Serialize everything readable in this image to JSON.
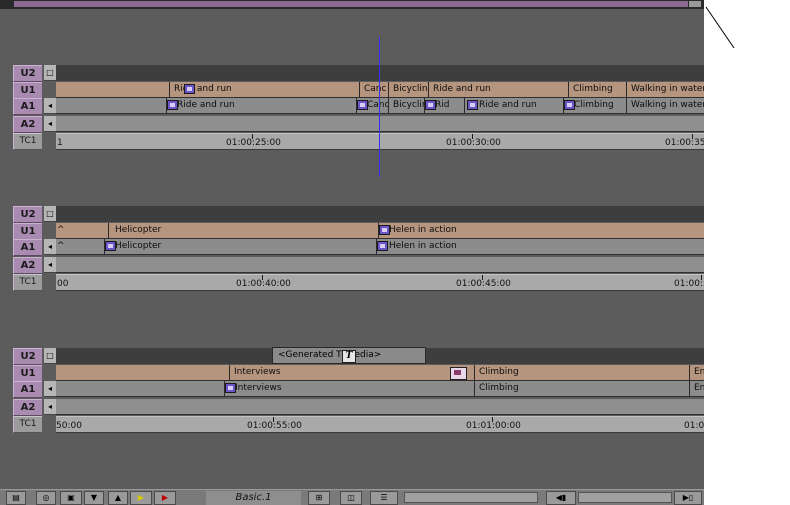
{
  "colors": {
    "video_track": "#b6957f",
    "audio_track": "#8c8c8c",
    "label": "#a98ab0",
    "cursor": "#3030ff"
  },
  "groups": [
    {
      "tracks": {
        "v2": "U2",
        "v1": "U1",
        "a1": "A1",
        "a2": "A2",
        "tc": "TC1"
      },
      "v1_clips": [
        "Ride and run",
        "Canc",
        "Bicyclin",
        "Ride and run",
        "Climbing",
        "Walking in water"
      ],
      "a1_clips": [
        "Ride and run",
        "Canc",
        "Bicyclin",
        "Rid",
        "Ride and run",
        "Climbing",
        "Walking in water"
      ],
      "timecodes": [
        "1",
        "01:00:25:00",
        "01:00:30:00",
        "01:00:35:"
      ]
    },
    {
      "tracks": {
        "v2": "U2",
        "v1": "U1",
        "a1": "A1",
        "a2": "A2",
        "tc": "TC1"
      },
      "v1_clips": [
        "^",
        "Helicopter",
        "Helen in action"
      ],
      "a1_clips": [
        "^",
        "Helicopter",
        "Helen in action"
      ],
      "timecodes": [
        "00",
        "01:00:40:00",
        "01:00:45:00",
        "01:00:5"
      ]
    },
    {
      "tracks": {
        "v2": "U2",
        "v1": "U1",
        "a1": "A1",
        "a2": "A2",
        "tc": "TC1"
      },
      "v2_clip": "<Generated Ti  Media>",
      "v1_clips": [
        "Interviews",
        "Climbing",
        "Env"
      ],
      "a1_clips": [
        "Interviews",
        "Climbing",
        "Env"
      ],
      "timecodes": [
        "50:00",
        "01:00:55:00",
        "01:01:00:00",
        "01:0"
      ]
    }
  ],
  "bottom": {
    "mode_label": "Basic.1",
    "title_icon": "T"
  }
}
